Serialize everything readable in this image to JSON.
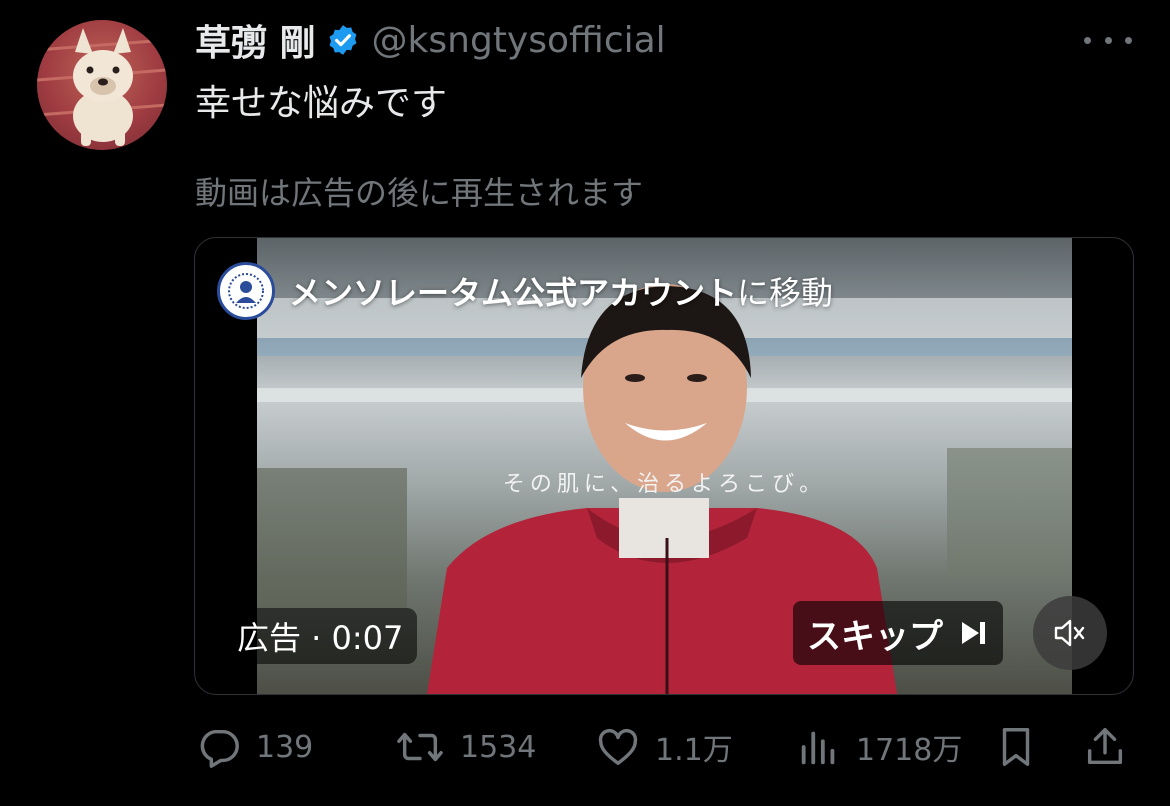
{
  "author": {
    "name": "草彅 剛",
    "handle": "@ksngtysofficial",
    "verified": true
  },
  "tweet": {
    "text": "幸せな悩みです",
    "media_notice": "動画は広告の後に再生されます"
  },
  "ad": {
    "advertiser_name": "メンソレータム公式アカウント",
    "advertiser_suffix": "に移動",
    "video_caption": "その肌に、治るよろこび。",
    "timer_label": "広告 · 0:07",
    "skip_label": "スキップ"
  },
  "metrics": {
    "replies": "139",
    "retweets": "1534",
    "likes": "1.1万",
    "views": "1718万"
  },
  "icons": {
    "more": "more-icon",
    "verified": "verified-badge-icon",
    "reply": "reply-icon",
    "retweet": "retweet-icon",
    "like": "heart-icon",
    "views": "views-bar-chart-icon",
    "bookmark": "bookmark-icon",
    "share": "share-icon",
    "skip": "skip-next-icon",
    "mute": "muted-speaker-icon"
  },
  "colors": {
    "background": "#000000",
    "text_primary": "#e7e9ea",
    "text_secondary": "#71767b",
    "verified_blue": "#1d9bf0",
    "border": "#2f3336"
  }
}
